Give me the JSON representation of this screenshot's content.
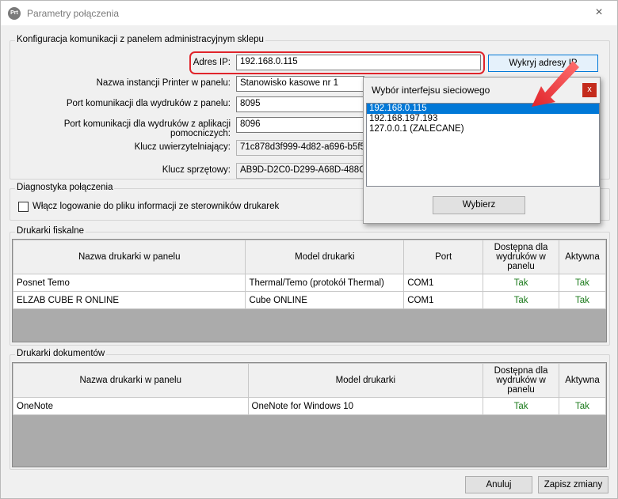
{
  "window": {
    "title": "Parametry połączenia",
    "icon": "app-icon",
    "close": "×"
  },
  "config": {
    "group_label": "Konfiguracja komunikacji z panelem administracyjnym sklepu",
    "ip_label": "Adres IP:",
    "ip_value": "192.168.0.115",
    "detect_button": "Wykryj adresy IP",
    "instance_label": "Nazwa instancji Printer w panelu:",
    "instance_value": "Stanowisko kasowe nr 1",
    "port_panel_label": "Port komunikacji dla wydruków z panelu:",
    "port_panel_value": "8095",
    "port_aux_label": "Port komunikacji dla wydruków z aplikacji pomocniczych:",
    "port_aux_value": "8096",
    "auth_key_label": "Klucz uwierzytelniający:",
    "auth_key_value": "71c878d3f999-4d82-a696-b5f5d",
    "hw_key_label": "Klucz sprzętowy:",
    "hw_key_value": "AB9D-D2C0-D299-A68D-488C-00"
  },
  "diagnostics": {
    "group_label": "Diagnostyka połączenia",
    "logging_label": "Włącz logowanie do pliku informacji ze sterowników drukarek",
    "logging_checked": false
  },
  "fiscal": {
    "group_label": "Drukarki fiskalne",
    "columns": [
      "Nazwa drukarki w panelu",
      "Model drukarki",
      "Port",
      "Dostępna dla wydruków w panelu",
      "Aktywna"
    ],
    "rows": [
      {
        "name": "Posnet Temo",
        "model": "Thermal/Temo (protokół Thermal)",
        "port": "COM1",
        "available": "Tak",
        "active": "Tak"
      },
      {
        "name": "ELZAB CUBE R ONLINE",
        "model": "Cube ONLINE",
        "port": "COM1",
        "available": "Tak",
        "active": "Tak"
      }
    ]
  },
  "documents": {
    "group_label": "Drukarki dokumentów",
    "columns": [
      "Nazwa drukarki w panelu",
      "Model drukarki",
      "Dostępna dla wydruków w panelu",
      "Aktywna"
    ],
    "rows": [
      {
        "name": "OneNote",
        "model": "OneNote for Windows 10",
        "available": "Tak",
        "active": "Tak"
      }
    ]
  },
  "footer": {
    "cancel": "Anuluj",
    "save": "Zapisz zmiany"
  },
  "popup": {
    "title": "Wybór interfejsu sieciowego",
    "close": "x",
    "items": [
      "192.168.0.115",
      "192.168.197.193",
      "127.0.0.1 (ZALECANE)"
    ],
    "selected_index": 0,
    "choose_button": "Wybierz"
  },
  "colors": {
    "highlight": "#e0242b",
    "selection": "#0078d7",
    "status_green": "#1a7a1a"
  }
}
